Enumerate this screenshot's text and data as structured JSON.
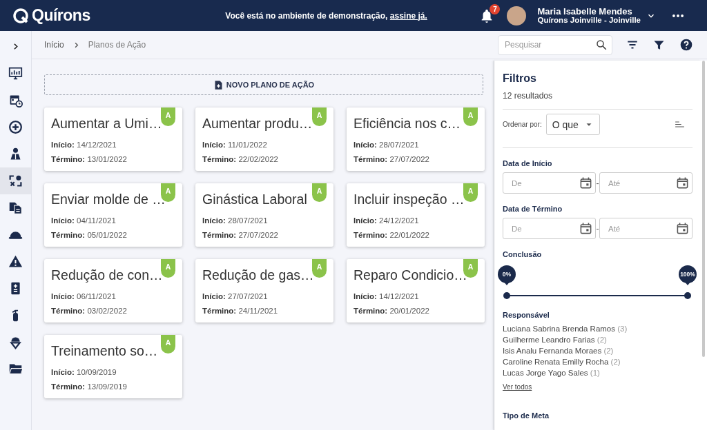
{
  "header": {
    "logo": "Quírons",
    "notice": "Você está no ambiente de demonstração,",
    "notice_link": "assine já.",
    "notifications": "7",
    "user_name": "Maria Isabelle Mendes",
    "user_unit": "Quírons Joinville - Joinville"
  },
  "sidebar": {
    "items": [
      {
        "selected": false
      },
      {
        "selected": false
      },
      {
        "selected": false
      },
      {
        "selected": false
      },
      {
        "selected": true
      },
      {
        "selected": false
      },
      {
        "selected": false
      },
      {
        "selected": false
      },
      {
        "selected": false
      },
      {
        "selected": false
      },
      {
        "selected": false
      },
      {
        "selected": false
      }
    ]
  },
  "breadcrumb": [
    "Início",
    "Planos de Ação"
  ],
  "search": {
    "placeholder": "Pesquisar"
  },
  "new_plan_button": "NOVO PLANO DE AÇÃO",
  "plans": [
    {
      "title": "Aumentar a Umi…",
      "badge": "A",
      "start_label": "Início:",
      "start": "14/12/2021",
      "end_label": "Término:",
      "end": "13/01/2022"
    },
    {
      "title": "Aumentar produ…",
      "badge": "A",
      "start_label": "Início:",
      "start": "11/01/2022",
      "end_label": "Término:",
      "end": "22/02/2022"
    },
    {
      "title": "Eficiência nos c…",
      "badge": "A",
      "start_label": "Início:",
      "start": "28/07/2021",
      "end_label": "Término:",
      "end": "27/07/2022"
    },
    {
      "title": "Enviar molde de …",
      "badge": "A",
      "start_label": "Início:",
      "start": "04/11/2021",
      "end_label": "Término:",
      "end": "05/01/2022"
    },
    {
      "title": "Ginástica Laboral",
      "badge": "A",
      "start_label": "Início:",
      "start": "28/07/2021",
      "end_label": "Término:",
      "end": "27/07/2022"
    },
    {
      "title": "Incluir inspeção …",
      "badge": "A",
      "start_label": "Início:",
      "start": "24/12/2021",
      "end_label": "Término:",
      "end": "22/01/2022"
    },
    {
      "title": "Redução de con…",
      "badge": "A",
      "start_label": "Início:",
      "start": "06/11/2021",
      "end_label": "Término:",
      "end": "03/02/2022"
    },
    {
      "title": "Redução de gas…",
      "badge": "A",
      "start_label": "Início:",
      "start": "27/07/2021",
      "end_label": "Término:",
      "end": "24/11/2021"
    },
    {
      "title": "Reparo Condicio…",
      "badge": "A",
      "start_label": "Início:",
      "start": "14/12/2021",
      "end_label": "Término:",
      "end": "20/01/2022"
    },
    {
      "title": "Treinamento so…",
      "badge": "A",
      "start_label": "Início:",
      "start": "10/09/2019",
      "end_label": "Término:",
      "end": "13/09/2019"
    }
  ],
  "filters": {
    "title": "Filtros",
    "results": "12 resultados",
    "sort_label": "Ordenar por:",
    "sort_value": "O que",
    "date_sections": [
      {
        "title": "Data de Início",
        "from_placeholder": "De",
        "separator": "-",
        "to_placeholder": "Até"
      },
      {
        "title": "Data de Término",
        "from_placeholder": "De",
        "separator": "-",
        "to_placeholder": "Até"
      }
    ],
    "completion": {
      "title": "Conclusão",
      "thumbs": [
        {
          "label": "0%",
          "level": 0
        },
        {
          "label": "100%",
          "level": 1
        }
      ]
    },
    "responsible": {
      "title": "Responsável",
      "people": [
        {
          "name": "Luciana Sabrina Brenda Ramos",
          "count": "(3)"
        },
        {
          "name": "Guilherme Leandro Farias",
          "count": "(2)"
        },
        {
          "name": "Isis Analu Fernanda Moraes",
          "count": "(2)"
        },
        {
          "name": "Caroline Renata Emilly Rocha",
          "count": "(2)"
        },
        {
          "name": "Lucas Jorge Yago Sales",
          "count": "(1)"
        }
      ],
      "link": "Ver todos"
    },
    "next_section": "Tipo de Meta"
  }
}
